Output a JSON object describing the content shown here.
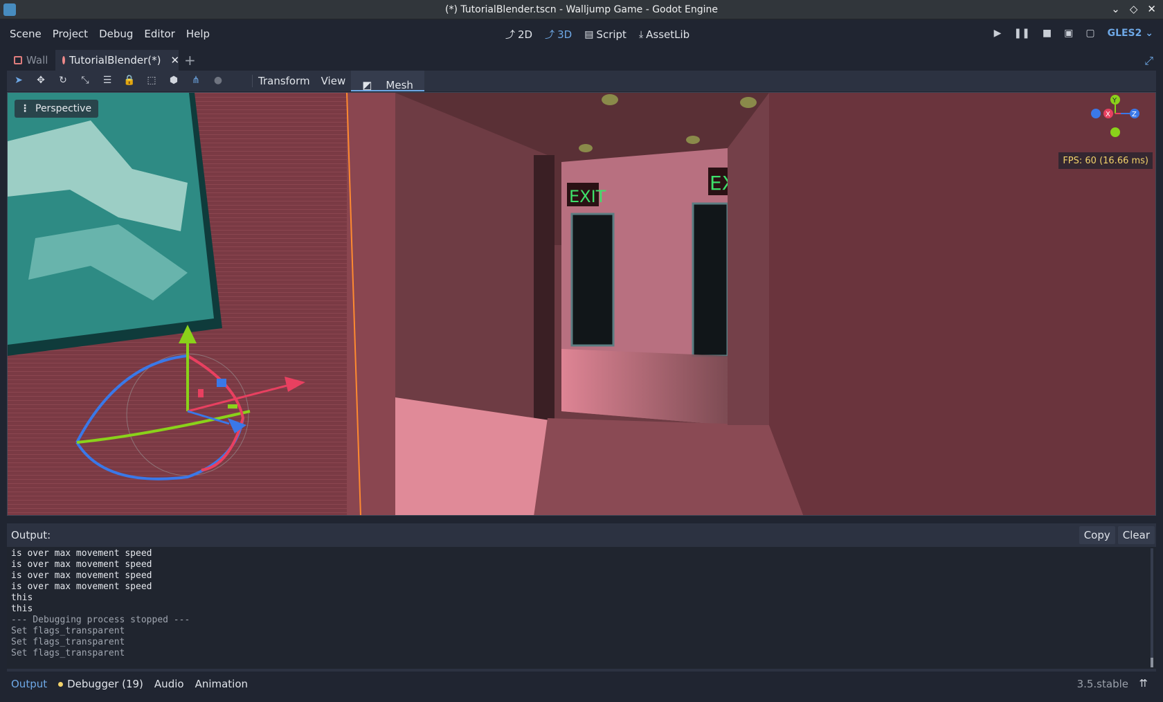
{
  "window": {
    "title": "(*) TutorialBlender.tscn - Walljump Game - Godot Engine",
    "icon": "godot-icon",
    "controls": [
      "⌄",
      "◇",
      "✕"
    ]
  },
  "menu": [
    "Scene",
    "Project",
    "Debug",
    "Editor",
    "Help"
  ],
  "workspaces": [
    {
      "label": "2D",
      "icon": "2d-icon",
      "active": false
    },
    {
      "label": "3D",
      "icon": "3d-icon",
      "active": true
    },
    {
      "label": "Script",
      "icon": "script-icon",
      "active": false
    },
    {
      "label": "AssetLib",
      "icon": "assetlib-icon",
      "active": false
    }
  ],
  "renderer": "GLES2",
  "tabs": [
    {
      "label": "Wall",
      "active": false
    },
    {
      "label": "TutorialBlender(*)",
      "active": true
    }
  ],
  "toolbar": {
    "menus": [
      "Transform",
      "View",
      "Mesh"
    ]
  },
  "viewport": {
    "perspective_label": "Perspective",
    "fps": "FPS: 60 (16.66 ms)",
    "exit_sign_1": "EXIT",
    "exit_sign_2": "EX",
    "gizmo_axes": {
      "x": "X",
      "y": "Y",
      "z": "Z"
    }
  },
  "output": {
    "title": "Output:",
    "copy_label": "Copy",
    "clear_label": "Clear",
    "lines": [
      {
        "text": "is over max movement speed",
        "style": "normal"
      },
      {
        "text": "is over max movement speed",
        "style": "normal"
      },
      {
        "text": "is over max movement speed",
        "style": "normal"
      },
      {
        "text": "is over max movement speed",
        "style": "normal"
      },
      {
        "text": "this",
        "style": "normal"
      },
      {
        "text": "this",
        "style": "normal"
      },
      {
        "text": "--- Debugging process stopped ---",
        "style": "grey"
      },
      {
        "text": "Set flags_transparent",
        "style": "grey"
      },
      {
        "text": "Set flags_transparent",
        "style": "grey"
      },
      {
        "text": "Set flags_transparent",
        "style": "grey"
      }
    ]
  },
  "bottom_tabs": {
    "output": "Output",
    "debugger": "Debugger (19)",
    "audio": "Audio",
    "animation": "Animation"
  },
  "version": "3.5.stable",
  "colors": {
    "accent": "#6ea8e6",
    "warning": "#f3d36b",
    "background": "#202531",
    "panel": "#2c3241"
  }
}
